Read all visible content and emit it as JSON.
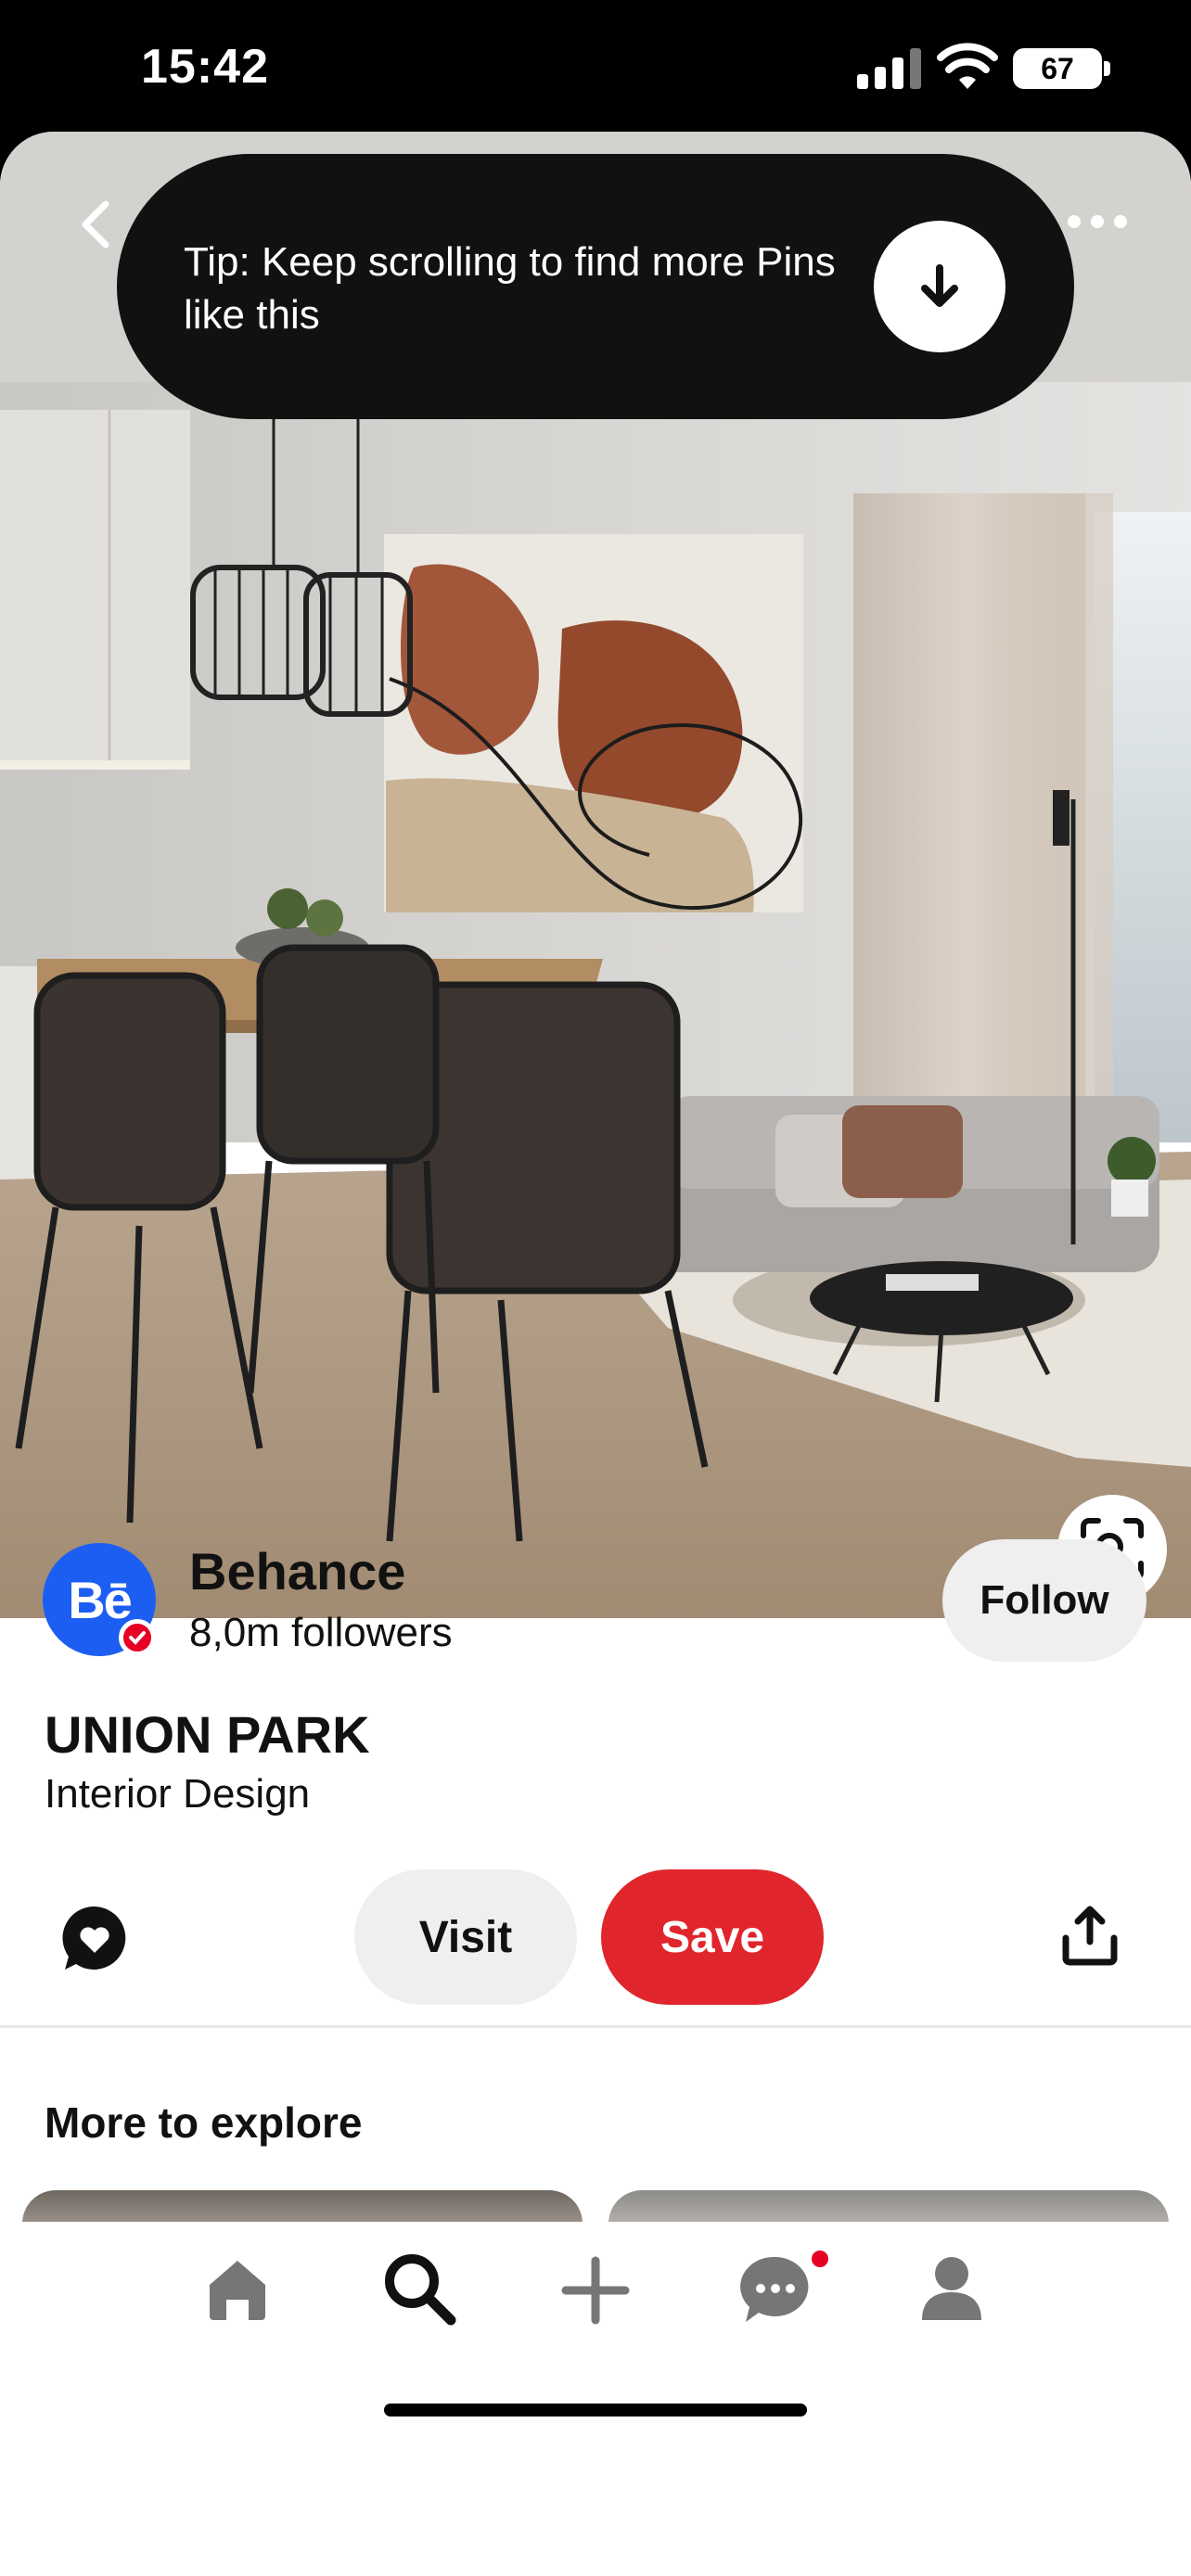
{
  "status_bar": {
    "time": "15:42",
    "battery": "67",
    "icons": [
      "cellular-signal-icon",
      "wifi-icon",
      "battery-icon"
    ]
  },
  "pin": {
    "image": "interior-living-room-photo",
    "tip": {
      "text": "Tip: Keep scrolling to find more Pins like this",
      "icon": "arrow-down-icon"
    },
    "creator": {
      "avatar_text": "Bē",
      "name": "Behance",
      "followers": "8,0m followers",
      "follow_label": "Follow"
    },
    "title": "UNION PARK",
    "subtitle": "Interior Design",
    "actions": {
      "visit_label": "Visit",
      "save_label": "Save"
    }
  },
  "more_to_explore": {
    "title": "More to explore"
  },
  "tab_bar": {
    "items": [
      "home",
      "search",
      "create",
      "messages",
      "profile"
    ],
    "active": "search"
  },
  "colors": {
    "save": "#e0262c",
    "brand_blue": "#1d5ef2",
    "notification": "#e60023"
  }
}
